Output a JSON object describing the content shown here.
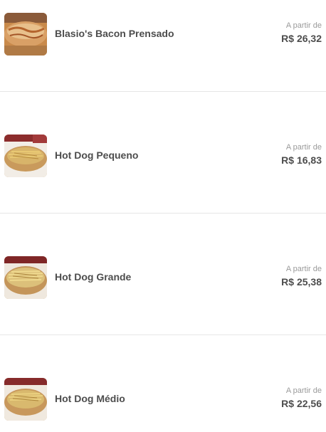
{
  "menu": {
    "items": [
      {
        "name": "Blasio's Bacon Prensado",
        "price_label": "A partir de",
        "price": "R$ 26,32",
        "image_icon": "bacon-sandwich-photo"
      },
      {
        "name": "Hot Dog Pequeno",
        "price_label": "A partir de",
        "price": "R$ 16,83",
        "image_icon": "hot-dog-photo"
      },
      {
        "name": "Hot Dog Grande",
        "price_label": "A partir de",
        "price": "R$ 25,38",
        "image_icon": "hot-dog-photo"
      },
      {
        "name": "Hot Dog Médio",
        "price_label": "A partir de",
        "price": "R$ 22,56",
        "image_icon": "hot-dog-photo"
      }
    ]
  },
  "colors": {
    "text": "#4d4d4d",
    "muted": "#9a9a9a",
    "divider": "#e6e6e6"
  }
}
